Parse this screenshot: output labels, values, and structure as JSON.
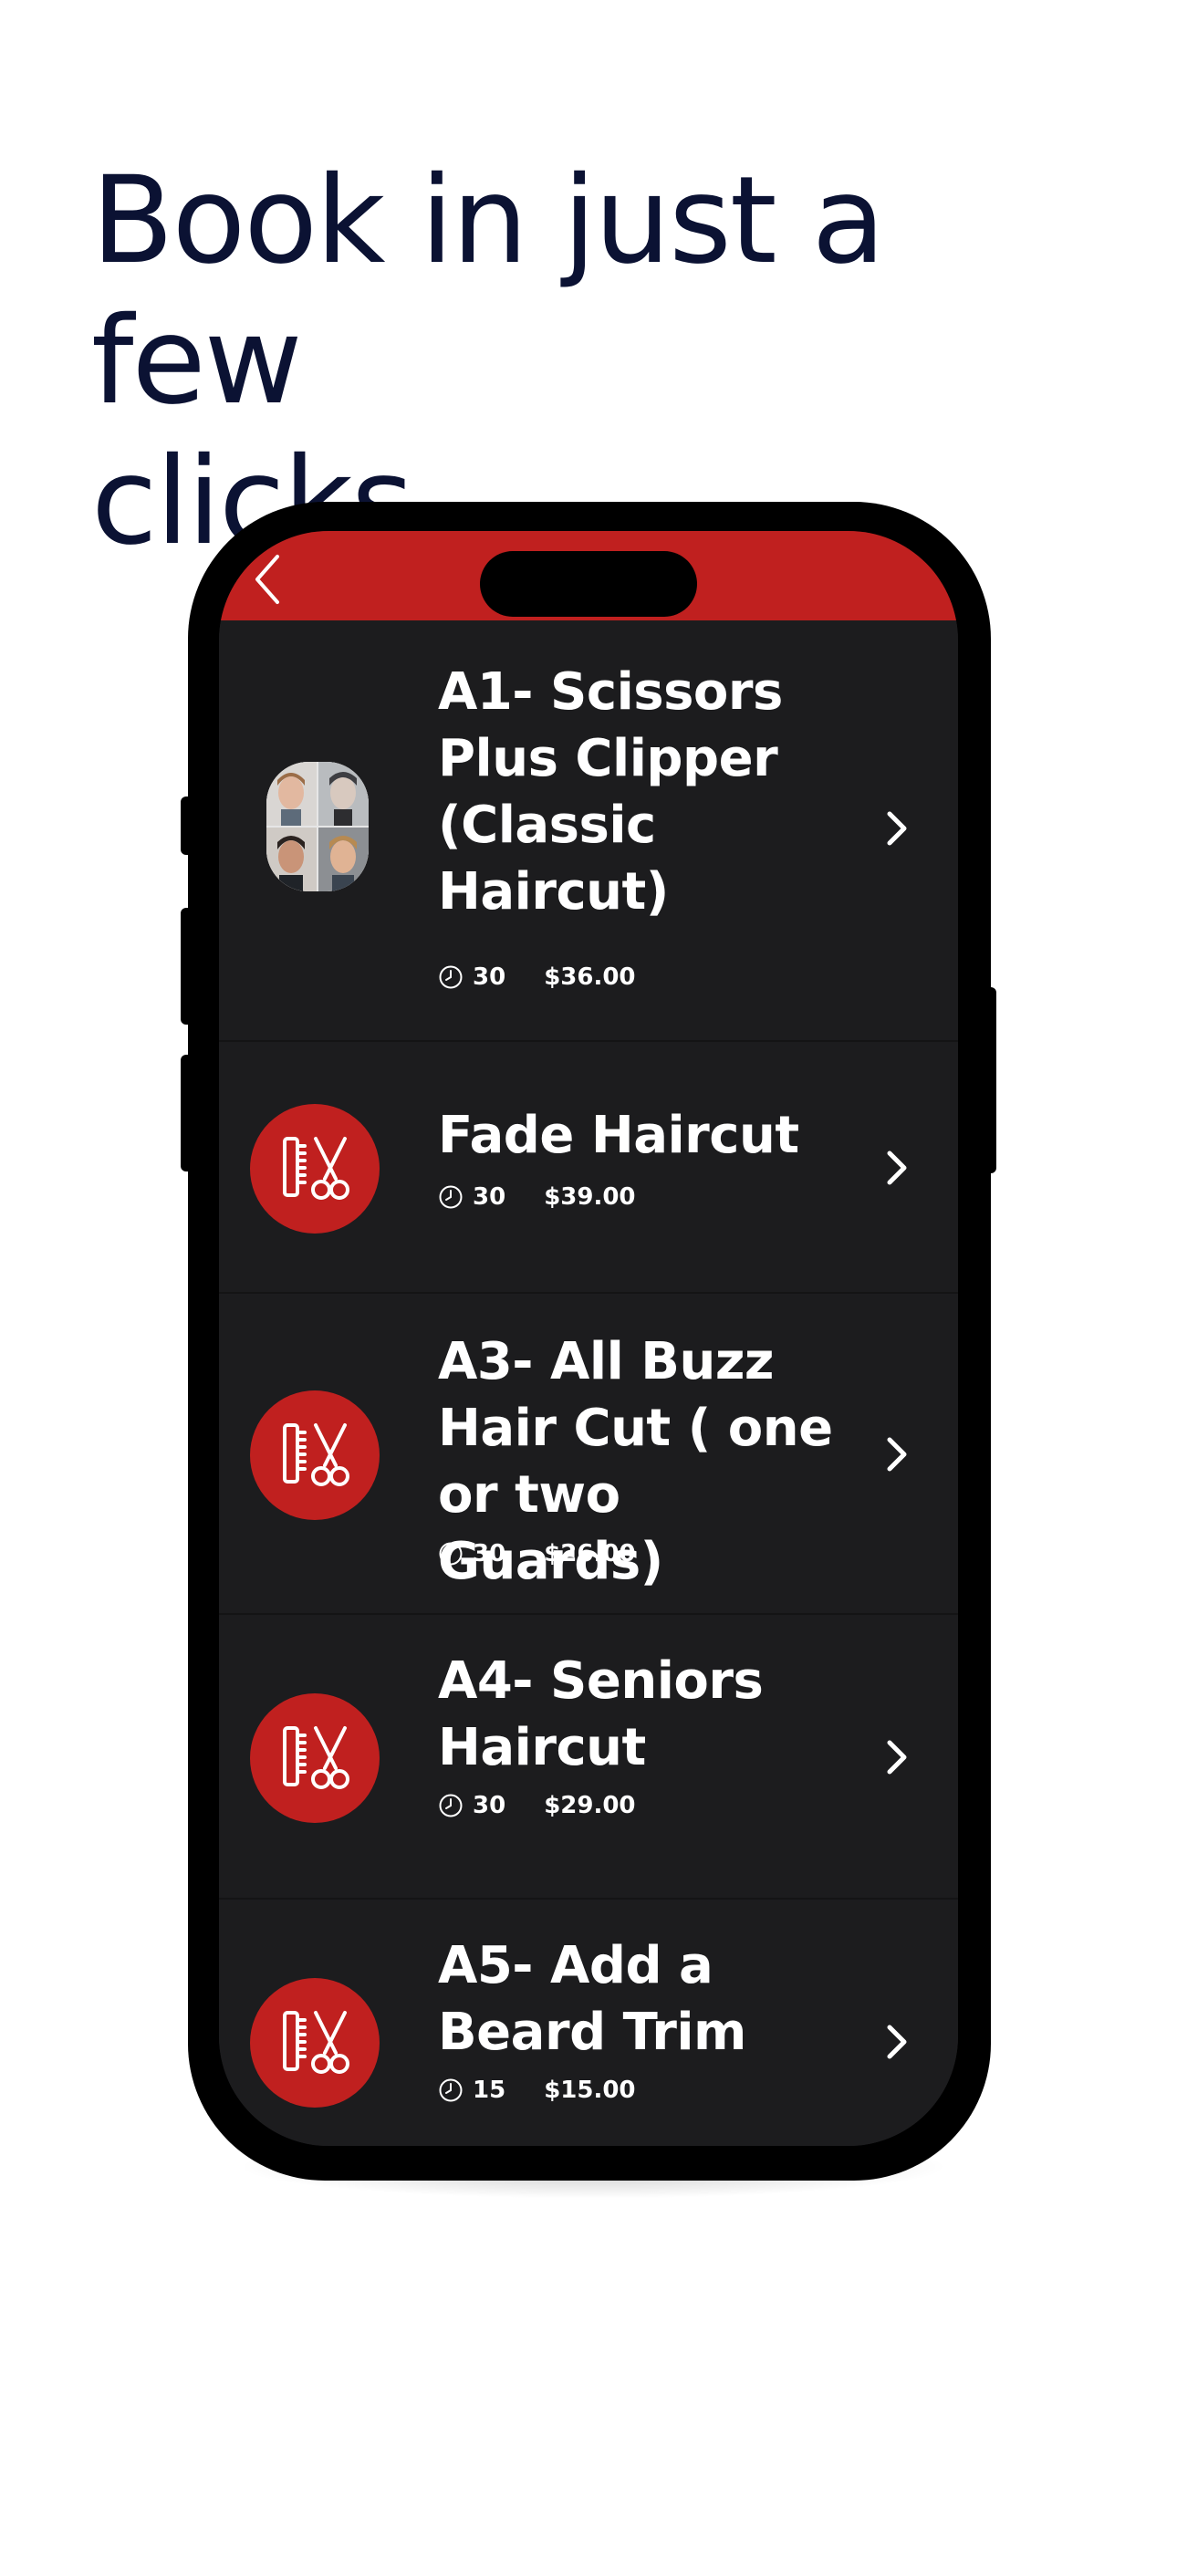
{
  "headline": {
    "line1": "Book in just a few",
    "line2": "clicks"
  },
  "colors": {
    "accent": "#c0201f",
    "headline": "#0b1233",
    "list_background": "#1c1c1e",
    "text": "#ffffff"
  },
  "header": {
    "back_icon": "chevron-left-icon"
  },
  "services": [
    {
      "title": "A1- Scissors Plus Clipper (Classic Haircut)",
      "duration": "30",
      "price": "$36.00",
      "icon": "haircut-photo-collage"
    },
    {
      "title": "Fade Haircut",
      "duration": "30",
      "price": "$39.00",
      "icon": "comb-scissors-icon"
    },
    {
      "title": "A3- All Buzz Hair Cut ( one or two Guards)",
      "duration": "30",
      "price": "$26.00",
      "icon": "comb-scissors-icon"
    },
    {
      "title": "A4- Seniors Haircut",
      "duration": "30",
      "price": "$29.00",
      "icon": "comb-scissors-icon"
    },
    {
      "title": "A5- Add a Beard Trim",
      "duration": "15",
      "price": "$15.00",
      "icon": "comb-scissors-icon"
    }
  ]
}
